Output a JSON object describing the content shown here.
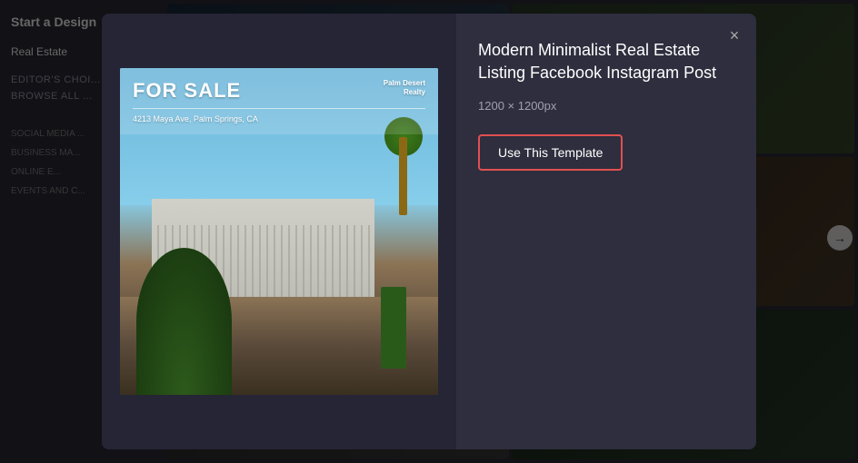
{
  "page": {
    "title": "Start a Design"
  },
  "sidebar": {
    "title": "Start a Design",
    "category": "Real Estate",
    "sections": [
      {
        "label": "EDITOR'S CHOICE",
        "type": "section"
      },
      {
        "label": "BROWSE ALL ...",
        "type": "section"
      }
    ],
    "groups": [
      {
        "label": "SOCIAL MEDIA ..."
      },
      {
        "label": "BUSINESS MA..."
      },
      {
        "label": "ONLINE E..."
      },
      {
        "label": "EVENTS AND C..."
      }
    ]
  },
  "modal": {
    "title": "Modern Minimalist Real Estate Listing Facebook Instagram Post",
    "dimensions": "1200 × 1200px",
    "use_button_label": "Use This Template",
    "close_label": "×"
  },
  "preview": {
    "for_sale": "FOR SALE",
    "address": "4213 Maya Ave, Palm Springs, CA",
    "brand_line1": "Palm Desert",
    "brand_line2": "Realty"
  },
  "nav": {
    "left_arrow": "←",
    "right_arrow": "→"
  }
}
